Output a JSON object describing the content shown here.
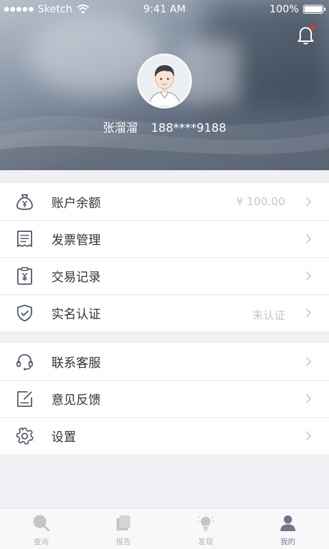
{
  "status_bar": {
    "carrier": "Sketch",
    "time": "9:41 AM",
    "battery": "100%"
  },
  "profile": {
    "name": "张溜溜",
    "phone": "188****9188"
  },
  "menu_group_1": [
    {
      "label": "账户余额",
      "value": "¥ 100.00",
      "icon": "money-bag-icon"
    },
    {
      "label": "发票管理",
      "value": "",
      "icon": "receipt-icon"
    },
    {
      "label": "交易记录",
      "value": "",
      "icon": "clipboard-yen-icon"
    },
    {
      "label": "实名认证",
      "value": "未认证",
      "icon": "shield-check-icon"
    }
  ],
  "menu_group_2": [
    {
      "label": "联系客服",
      "icon": "headset-icon"
    },
    {
      "label": "意见反馈",
      "icon": "edit-note-icon"
    },
    {
      "label": "设置",
      "icon": "gear-icon"
    }
  ],
  "tabbar": [
    {
      "label": "查询",
      "icon": "search-icon",
      "active": false
    },
    {
      "label": "报告",
      "icon": "report-icon",
      "active": false
    },
    {
      "label": "发现",
      "icon": "lightbulb-icon",
      "active": false
    },
    {
      "label": "我的",
      "icon": "person-icon",
      "active": true
    }
  ],
  "colors": {
    "notification_dot": "#f0302e",
    "active_tab": "#7a8393",
    "inactive_tab": "#c5c5c5",
    "icon_stroke": "#4d5566"
  }
}
